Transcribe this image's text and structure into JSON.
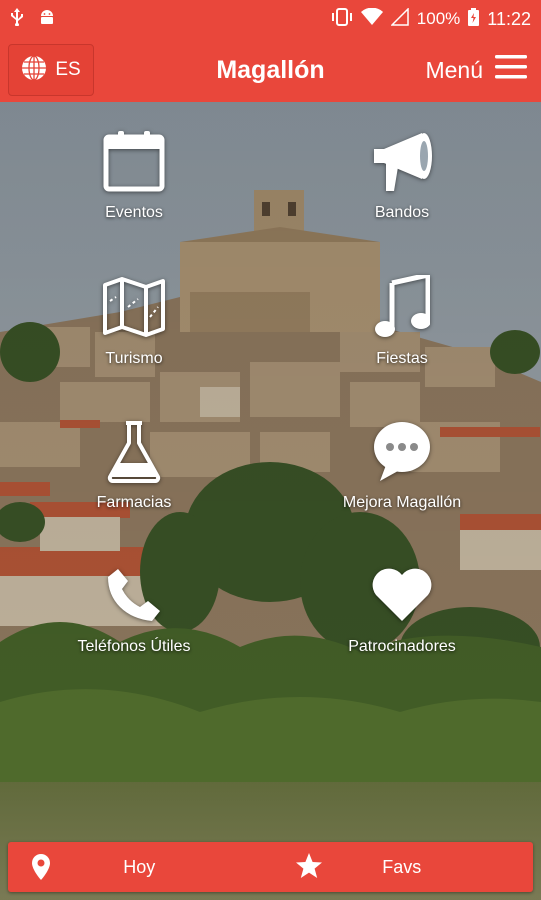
{
  "status_bar": {
    "battery": "100%",
    "time": "11:22",
    "icons": [
      "usb-icon",
      "android-icon",
      "vibrate-icon",
      "wifi-icon",
      "signal-icon",
      "battery-icon"
    ]
  },
  "app_bar": {
    "language": "ES",
    "title": "Magallón",
    "menu_label": "Menú"
  },
  "grid": [
    {
      "label": "Eventos",
      "icon": "calendar-icon"
    },
    {
      "label": "Bandos",
      "icon": "megaphone-icon"
    },
    {
      "label": "Turismo",
      "icon": "map-icon"
    },
    {
      "label": "Fiestas",
      "icon": "music-note-icon"
    },
    {
      "label": "Farmacias",
      "icon": "flask-icon"
    },
    {
      "label": "Mejora Magallón",
      "icon": "chat-bubble-icon"
    },
    {
      "label": "Teléfonos Útiles",
      "icon": "phone-icon"
    },
    {
      "label": "Patrocinadores",
      "icon": "heart-icon"
    }
  ],
  "bottom_bar": {
    "today_label": "Hoy",
    "favs_label": "Favs"
  },
  "colors": {
    "brand": "#e9473b",
    "sky": "#a9b3ba",
    "foliage": "#3f5a2a"
  }
}
